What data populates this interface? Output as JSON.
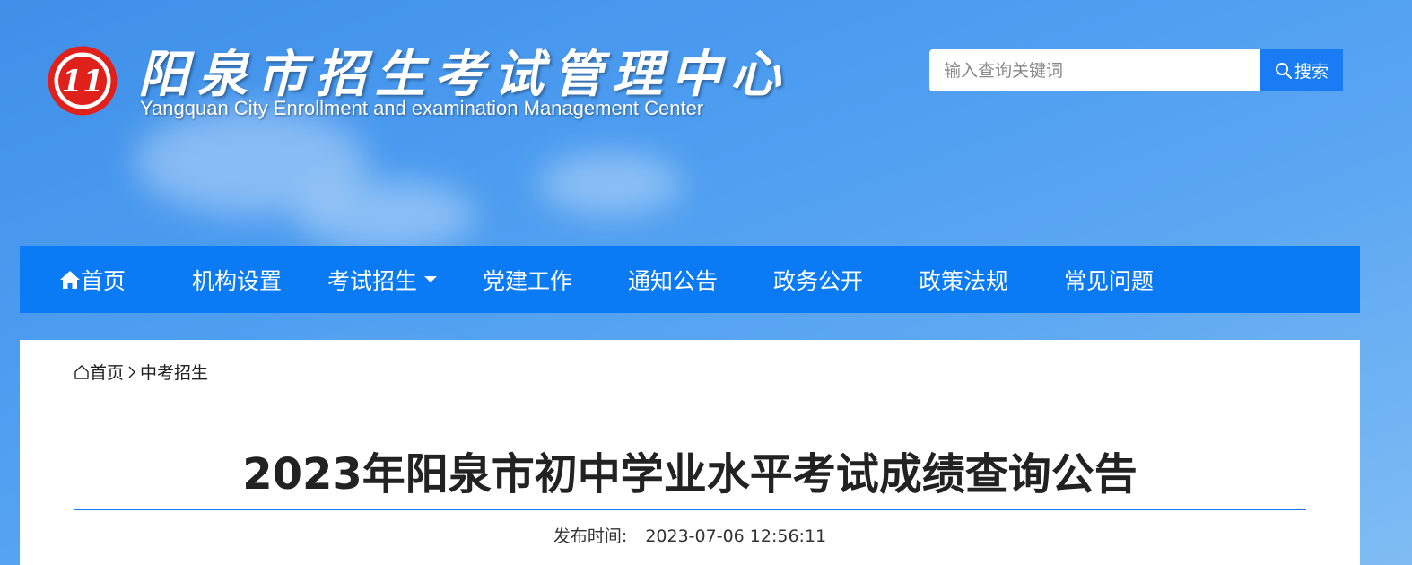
{
  "header": {
    "title_cn": "阳泉市招生考试管理中心",
    "title_en": "Yangquan City Enrollment and examination Management Center",
    "logo_text": "11",
    "logo_color": "#e0211b"
  },
  "search": {
    "placeholder": "输入查询关键词",
    "button_label": "搜索",
    "button_icon": "search-icon"
  },
  "nav": {
    "home_icon": "home-icon",
    "items": [
      {
        "label": "首页"
      },
      {
        "label": "机构设置"
      },
      {
        "label": "考试招生"
      },
      {
        "label": "党建工作"
      },
      {
        "label": "通知公告"
      },
      {
        "label": "政务公开"
      },
      {
        "label": "政策法规"
      },
      {
        "label": "常见问题"
      }
    ],
    "color": "#0a7bf5"
  },
  "breadcrumb": {
    "home": "首页",
    "separator": ">",
    "current": "中考招生"
  },
  "article": {
    "title": "2023年阳泉市初中学业水平考试成绩查询公告",
    "published_label": "发布时间:",
    "published_value": "2023-07-06 12:56:11"
  }
}
